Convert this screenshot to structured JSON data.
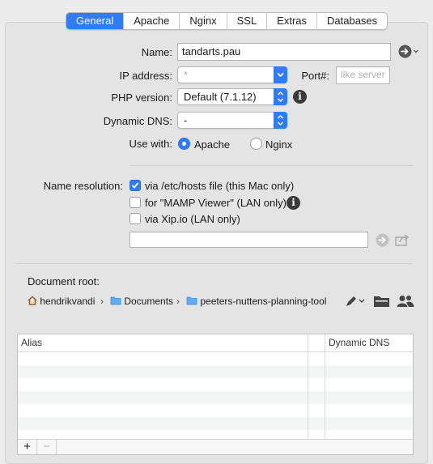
{
  "tabs": [
    {
      "label": "General",
      "active": true
    },
    {
      "label": "Apache"
    },
    {
      "label": "Nginx"
    },
    {
      "label": "SSL"
    },
    {
      "label": "Extras"
    },
    {
      "label": "Databases"
    }
  ],
  "form": {
    "name_label": "Name:",
    "name_value": "tandarts.pau",
    "ip_label": "IP address:",
    "ip_value": "*",
    "port_label": "Port#:",
    "port_placeholder": "like server",
    "php_label": "PHP version:",
    "php_value": "Default (7.1.12)",
    "dns_label": "Dynamic DNS:",
    "dns_value": "-",
    "usewith_label": "Use with:",
    "usewith_options": [
      "Apache",
      "Nginx"
    ],
    "usewith_selected": "Apache"
  },
  "resolution": {
    "label": "Name resolution:",
    "options": [
      {
        "label": "via /etc/hosts file (this Mac only)",
        "checked": true
      },
      {
        "label": "for \"MAMP Viewer\" (LAN only)",
        "checked": false
      },
      {
        "label": "via Xip.io (LAN only)",
        "checked": false
      }
    ],
    "xip_value": ""
  },
  "docroot": {
    "label": "Document root:",
    "path": [
      "hendrikvandi",
      "Documents",
      "peeters-nuttens-planning-tool"
    ]
  },
  "alias_table": {
    "columns": [
      "Alias",
      "Dynamic DNS"
    ],
    "rows": [],
    "add_label": "+",
    "remove_label": "−"
  },
  "colors": {
    "accent": "#2f7cf6"
  },
  "icons": [
    "go-arrow-icon",
    "info-icon",
    "home-icon",
    "folder-icon",
    "pen-icon",
    "open-folder-icon",
    "users-icon",
    "share-icon"
  ]
}
